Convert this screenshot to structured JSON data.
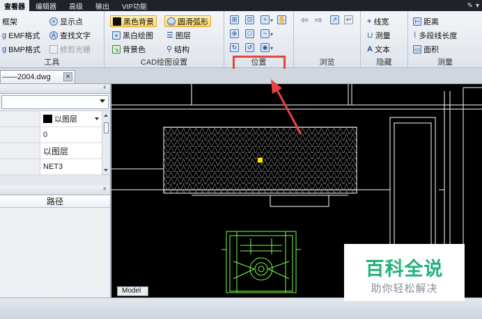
{
  "menubar": {
    "items": [
      "查看器",
      "编辑器",
      "高级",
      "输出",
      "VIP功能"
    ]
  },
  "ribbon": {
    "tools_group": {
      "label": "工具",
      "buttons": [
        "框架",
        "显示点",
        "EMF格式",
        "查找文字",
        "BMP格式",
        "修剪光栅"
      ]
    },
    "cad_group": {
      "label": "CAD绘图设置",
      "buttons": [
        "黑色背景",
        "圆滑弧形",
        "黑白绘图",
        "图层",
        "背景色",
        "结构"
      ]
    },
    "position_group": {
      "label": "位置"
    },
    "browse_group": {
      "label": "浏览"
    },
    "hide_group": {
      "label": "隐藏",
      "buttons": [
        "线宽",
        "测量",
        "文本"
      ]
    },
    "measure_group": {
      "label": "测量",
      "buttons": [
        "距离",
        "多段线长度",
        "面积"
      ]
    }
  },
  "document": {
    "tab_label": "——2004.dwg",
    "close_glyph": "✕"
  },
  "properties": {
    "pin_glyph": "ᵖ",
    "rows": [
      {
        "value": "以图层"
      },
      {
        "value": "0"
      },
      {
        "value": "以图层"
      },
      {
        "value": "NET3"
      }
    ]
  },
  "file_panel": {
    "pin_glyph": "ᵖ",
    "column_header": "路径"
  },
  "canvas": {
    "model_tab": "Model"
  },
  "watermark": {
    "title": "百科全说",
    "subtitle": "助你轻松解决"
  },
  "colors": {
    "canvas_bg": "#000000",
    "drawing_lines": "#ffffff",
    "equipment_lines": "#7cff4a",
    "highlight": "#e8433f",
    "watermark_green": "#21b27a"
  }
}
